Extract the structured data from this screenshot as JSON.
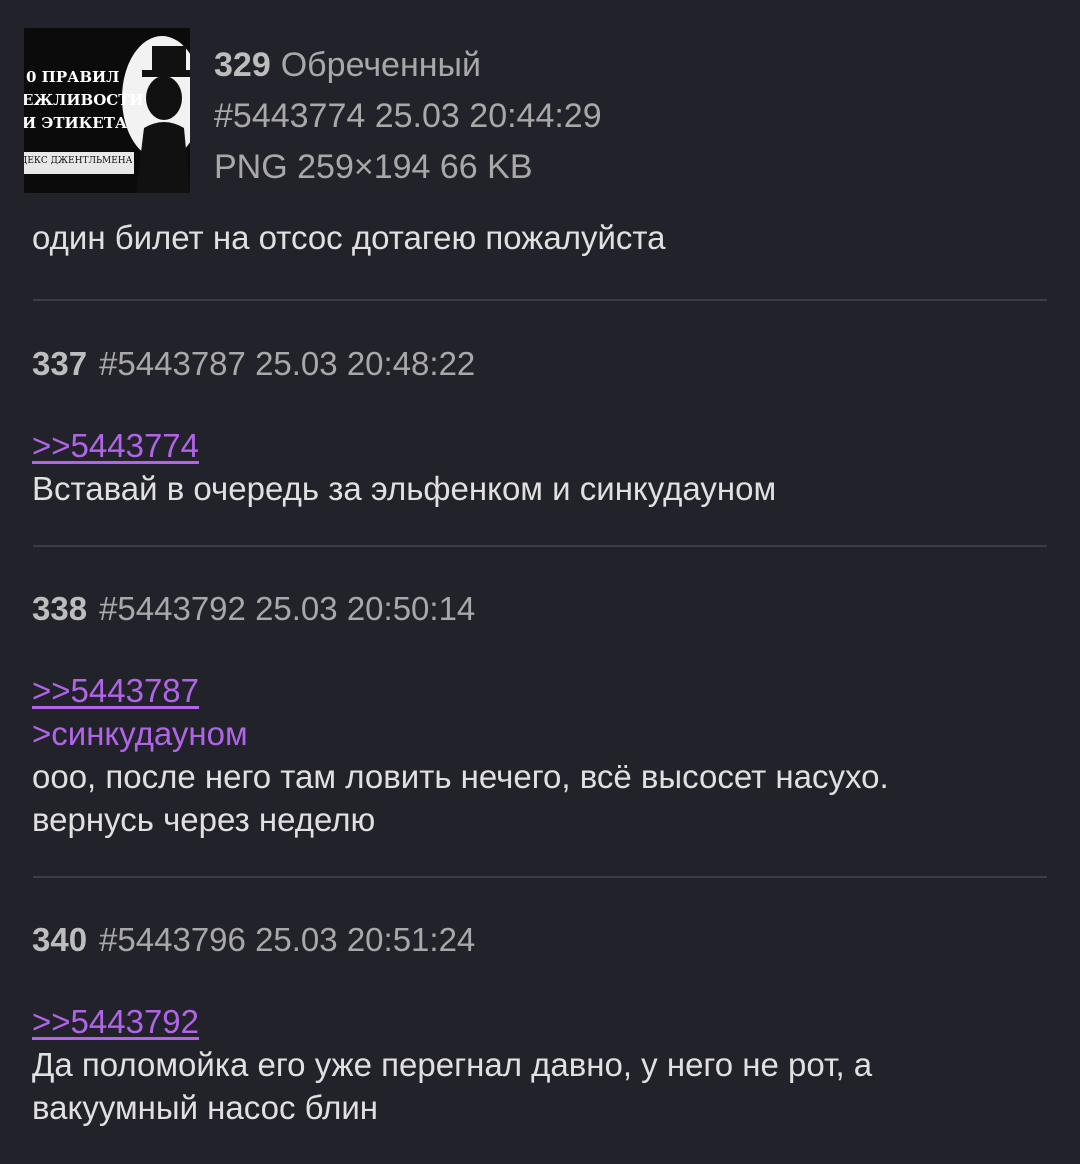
{
  "posts": [
    {
      "num": "329",
      "name": "Обреченный",
      "id": "#5443774",
      "date": "25.03",
      "time": "20:44:29",
      "file_info": "PNG 259×194 66 KB",
      "thumbnail": {
        "lines": [
          "0 ПРАВИЛ",
          "ЕЖЛИВОСТИ",
          "И ЭТИКЕТА",
          "ДЕКС ДЖЕНТЛЬМЕНА"
        ]
      },
      "text": "один билет на отсос дотагею пожалуйста"
    },
    {
      "num": "337",
      "id": "#5443787",
      "date": "25.03",
      "time": "20:48:22",
      "reply_to": ">>5443774",
      "lines": [
        "Вставай в очередь за эльфенком и синкудауном"
      ]
    },
    {
      "num": "338",
      "id": "#5443792",
      "date": "25.03",
      "time": "20:50:14",
      "reply_to": ">>5443787",
      "quote": ">синкудауном",
      "lines": [
        "ооо, после него там ловить нечего, всё высосет насухо.",
        "вернусь через неделю"
      ]
    },
    {
      "num": "340",
      "id": "#5443796",
      "date": "25.03",
      "time": "20:51:24",
      "reply_to": ">>5443792",
      "lines": [
        "Да поломойка его уже перегнал давно, у него не рот, а",
        "вакуумный насос блин"
      ]
    }
  ],
  "colors": {
    "background": "#22222a",
    "link": "#b264e8",
    "meta": "#a8a8a8",
    "text": "#e0e0e0",
    "divider": "#3c3c46"
  }
}
